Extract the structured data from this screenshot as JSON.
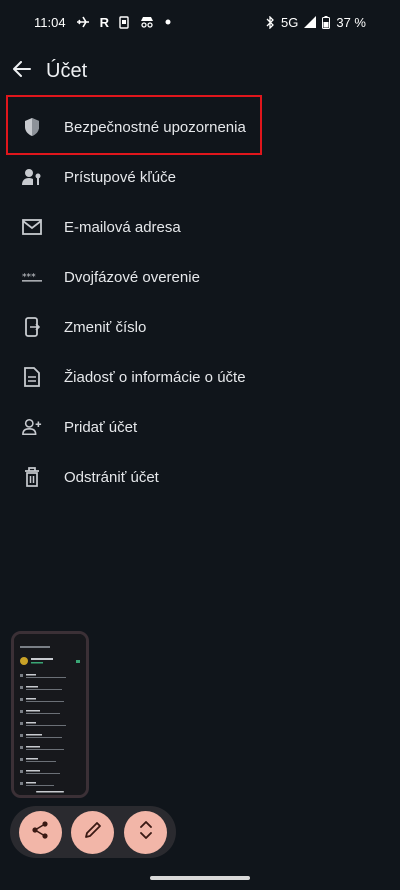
{
  "status": {
    "time": "11:04",
    "network": "5G",
    "battery": "37 %",
    "icons_left": [
      "airplane-icon",
      "r-icon",
      "id-card-icon",
      "incognito-icon",
      "dot-icon"
    ],
    "icons_right": [
      "bluetooth-icon",
      "signal-icon",
      "battery-icon"
    ]
  },
  "header": {
    "title": "Účet"
  },
  "menu": [
    {
      "label": "Bezpečnostné upozornenia",
      "icon": "shield-icon"
    },
    {
      "label": "Prístupové kľúče",
      "icon": "passkey-icon"
    },
    {
      "label": "E-mailová adresa",
      "icon": "mail-icon"
    },
    {
      "label": "Dvojfázové overenie",
      "icon": "password-icon"
    },
    {
      "label": "Zmeniť číslo",
      "icon": "phone-transfer-icon"
    },
    {
      "label": "Žiadosť o informácie o účte",
      "icon": "document-icon"
    },
    {
      "label": "Pridať účet",
      "icon": "person-add-icon"
    },
    {
      "label": "Odstrániť účet",
      "icon": "trash-icon"
    }
  ],
  "actions": [
    "share-icon",
    "edit-icon",
    "expand-icon"
  ],
  "colors": {
    "background": "#10151b",
    "highlight": "#e0161c",
    "fab": "#f2b6a8"
  }
}
